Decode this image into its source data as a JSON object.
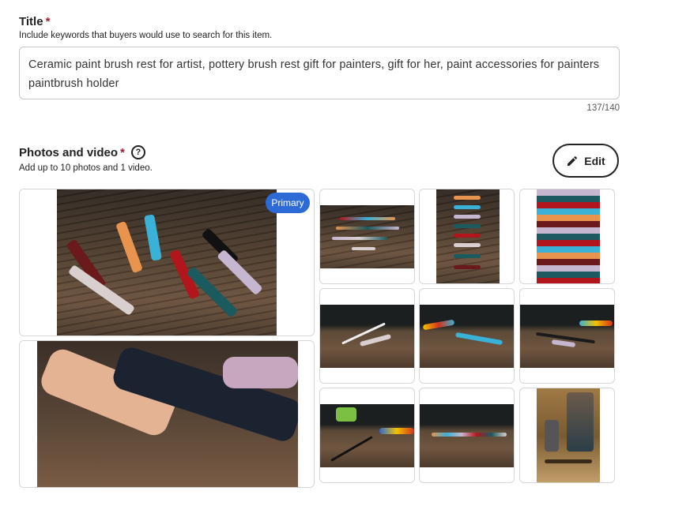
{
  "title_field": {
    "label": "Title",
    "required_mark": "*",
    "help": "Include keywords that buyers would use to search for this item.",
    "value": "Ceramic paint brush rest for artist, pottery brush rest gift for painters, gift for her, paint accessories for painters paintbrush holder",
    "counter": "137/140"
  },
  "photos": {
    "label": "Photos and video",
    "required_mark": "*",
    "help_icon_glyph": "?",
    "help": "Add up to 10 photos and 1 video.",
    "edit_label": "Edit",
    "primary_badge": "Primary",
    "tiles": [
      {
        "name": "photo-1-primary",
        "subject": "assorted colored brush rests on wood"
      },
      {
        "name": "photo-2",
        "subject": "closeup of brush rests"
      },
      {
        "name": "photo-3",
        "subject": "brush rests laid flat"
      },
      {
        "name": "photo-4",
        "subject": "brush rests stacked vertically"
      },
      {
        "name": "photo-5",
        "subject": "stacked rests closeup"
      },
      {
        "name": "photo-6",
        "subject": "brushes on rest"
      },
      {
        "name": "photo-7",
        "subject": "brushes and markers on rest"
      },
      {
        "name": "photo-8",
        "subject": "brushes and markers"
      },
      {
        "name": "photo-9",
        "subject": "paint tubes and brushes"
      },
      {
        "name": "photo-10",
        "subject": "row of rests"
      },
      {
        "name": "photo-11",
        "subject": "easel with painting"
      }
    ]
  },
  "colors": {
    "required": "#a61a2e",
    "badge": "#2d6ad6",
    "border": "#c7c7c7"
  }
}
